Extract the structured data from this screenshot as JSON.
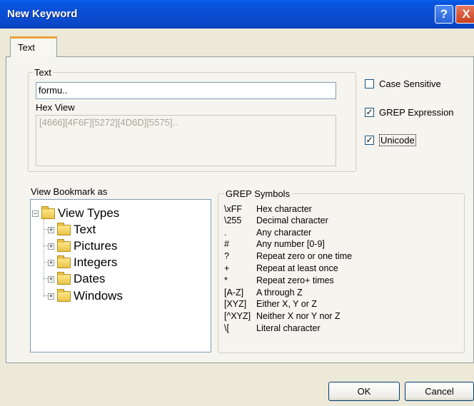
{
  "window": {
    "title": "New Keyword",
    "help_label": "?",
    "close_label": "X"
  },
  "tabs": [
    {
      "label": "Text",
      "selected": true
    }
  ],
  "text_group": {
    "legend": "Text",
    "text_value": "formu..",
    "hex_label": "Hex View",
    "hex_value": "[4666][4F6F][5272][4D6D][5575].."
  },
  "options": [
    {
      "label": "Case Sensitive",
      "checked": false
    },
    {
      "label": "GREP Expression",
      "checked": true
    },
    {
      "label": "Unicode",
      "checked": true
    }
  ],
  "bookmark": {
    "label": "View Bookmark as",
    "tree": {
      "root": "View Types",
      "children": [
        "Text",
        "Pictures",
        "Integers",
        "Dates",
        "Windows"
      ]
    }
  },
  "grep": {
    "legend": "GREP Symbols",
    "symbols": [
      {
        "key": "\\xFF",
        "desc": "Hex character"
      },
      {
        "key": "\\255",
        "desc": "Decimal character"
      },
      {
        "key": ".",
        "desc": "Any character"
      },
      {
        "key": "#",
        "desc": "Any number [0-9]"
      },
      {
        "key": "?",
        "desc": "Repeat zero or one time"
      },
      {
        "key": "+",
        "desc": "Repeat at least once"
      },
      {
        "key": "*",
        "desc": "Repeat zero+ times"
      },
      {
        "key": "[A-Z]",
        "desc": "A through Z"
      },
      {
        "key": "[XYZ]",
        "desc": "Either X, Y or Z"
      },
      {
        "key": "[^XYZ]",
        "desc": "Neither X nor Y nor Z"
      },
      {
        "key": "\\[",
        "desc": "Literal character"
      }
    ]
  },
  "buttons": {
    "ok": "OK",
    "cancel": "Cancel"
  },
  "colors": {
    "titlebar": "#0A4FD6",
    "dialog_bg": "#ECE9D8",
    "tab_accent": "#E8A33A"
  },
  "icons": {
    "folder": "folder-icon",
    "expand": "plus-expander-icon",
    "collapse": "minus-expander-icon",
    "check": "checkmark-icon"
  }
}
